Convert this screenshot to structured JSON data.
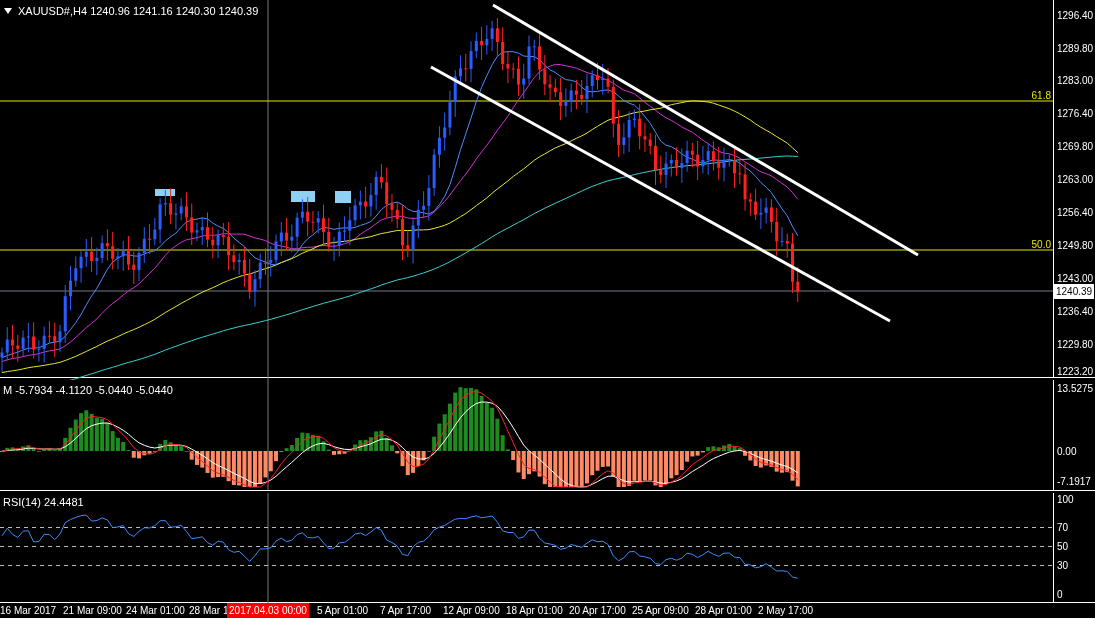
{
  "header": {
    "text": "XAUUSD#,H4  1240.96 1241.16 1240.30 1240.39"
  },
  "price_panel": {
    "levels": [
      {
        "label": "61.8"
      },
      {
        "label": "50.0"
      }
    ],
    "yticks": [
      "1296.40",
      "1289.80",
      "1283.00",
      "1276.40",
      "1269.80",
      "1263.00",
      "1256.40",
      "1249.80",
      "1243.00",
      "1236.40",
      "1229.80",
      "1223.20"
    ],
    "current_price": "1240.39"
  },
  "macd_panel": {
    "label": "M -5.7934 -4.1120 -5.0440 -5.0440",
    "yticks": [
      "13.5275",
      "0.00",
      "-7.1917"
    ]
  },
  "rsi_panel": {
    "label": "RSI(14) 24.4481",
    "yticks": [
      "100",
      "70",
      "50",
      "30",
      "0"
    ]
  },
  "time_axis": [
    {
      "kind": "date",
      "label": "16 Mar 2017"
    },
    {
      "kind": "date",
      "label": "21 Mar 09:00"
    },
    {
      "kind": "date",
      "label": "24 Mar 01:00"
    },
    {
      "kind": "date",
      "label": "28 Mar 1"
    },
    {
      "kind": "cursor",
      "label": "2017.04.03 00:00"
    },
    {
      "kind": "date",
      "label": "5 Apr 01:00"
    },
    {
      "kind": "date",
      "label": "7 Apr 17:00"
    },
    {
      "kind": "date",
      "label": "12 Apr 09:00"
    },
    {
      "kind": "date",
      "label": "18 Apr 01:00"
    },
    {
      "kind": "date",
      "label": "20 Apr 17:00"
    },
    {
      "kind": "date",
      "label": "25 Apr 09:00"
    },
    {
      "kind": "date",
      "label": "28 Apr 01:00"
    },
    {
      "kind": "date",
      "label": "2 May 17:00"
    }
  ]
}
